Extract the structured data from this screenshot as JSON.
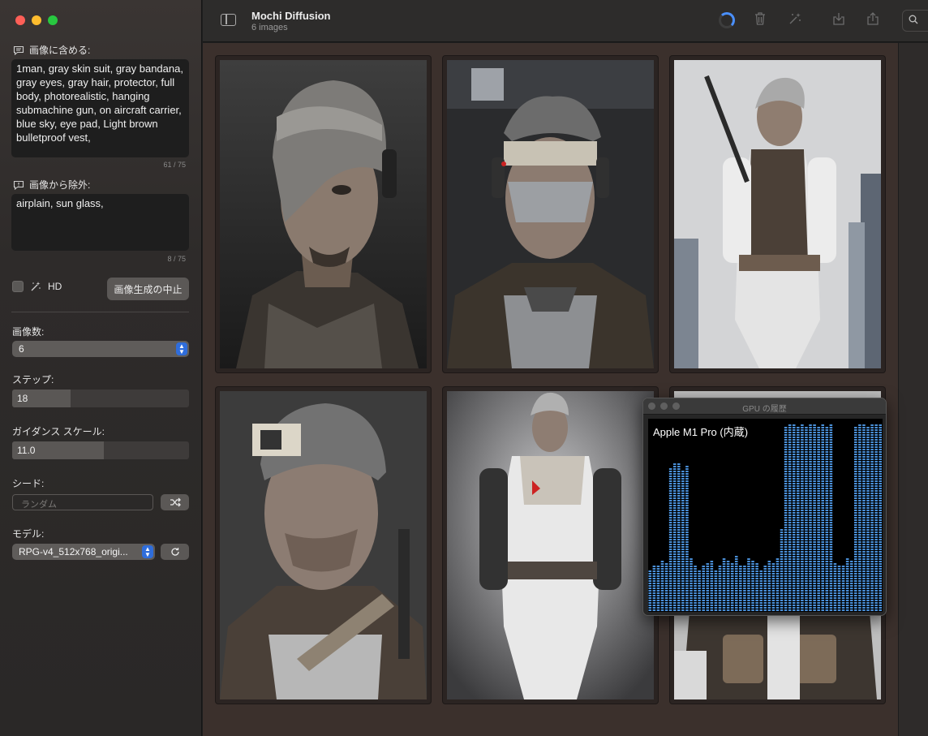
{
  "window": {
    "title": "Mochi Diffusion",
    "subtitle": "6 images"
  },
  "prompt": {
    "label": "画像に含める:",
    "text": "1man, gray skin suit, gray bandana, gray eyes, gray hair, protector, full body, photorealistic, hanging submachine gun, on aircraft carrier, blue sky, eye pad, Light brown bulletproof vest,",
    "counter": "61 / 75"
  },
  "negative_prompt": {
    "label": "画像から除外:",
    "text": "airplain, sun glass,",
    "counter": "8 / 75"
  },
  "hd": {
    "label": "HD",
    "checked": false
  },
  "stop_button": "画像生成の中止",
  "image_count": {
    "label": "画像数:",
    "value": "6"
  },
  "steps": {
    "label": "ステップ:",
    "value": "18",
    "fraction": 0.33
  },
  "guidance": {
    "label": "ガイダンス スケール:",
    "value": "11.0",
    "fraction": 0.52
  },
  "seed": {
    "label": "シード:",
    "placeholder": "ランダム"
  },
  "model": {
    "label": "モデル:",
    "value": "RPG-v4_512x768_origi..."
  },
  "gpu_window": {
    "title": "GPU の履歴",
    "device": "Apple M1 Pro (内蔵)",
    "bar_color": "#4a90d9",
    "usage": [
      0.22,
      0.25,
      0.24,
      0.27,
      0.26,
      0.75,
      0.78,
      0.77,
      0.74,
      0.76,
      0.28,
      0.25,
      0.22,
      0.24,
      0.26,
      0.27,
      0.22,
      0.25,
      0.28,
      0.27,
      0.26,
      0.29,
      0.25,
      0.24,
      0.28,
      0.27,
      0.26,
      0.22,
      0.25,
      0.27,
      0.26,
      0.28,
      0.43,
      0.97,
      0.98,
      0.98,
      0.97,
      0.98,
      0.97,
      0.98,
      0.98,
      0.97,
      0.98,
      0.97,
      0.98,
      0.26,
      0.25,
      0.24,
      0.28,
      0.27,
      0.97,
      0.98,
      0.98,
      0.97,
      0.98,
      0.98,
      0.98
    ]
  },
  "colors": {
    "accent": "#2f6ddb",
    "spinner": "#4a90ff",
    "gallery_bg": "#3b302c"
  },
  "icons": {
    "sidebar_toggle": "sidebar-toggle-icon",
    "trash": "trash-icon",
    "wand": "magic-wand-icon",
    "import": "import-icon",
    "share": "share-icon",
    "search": "search-icon",
    "shuffle": "shuffle-icon",
    "refresh": "refresh-icon"
  }
}
